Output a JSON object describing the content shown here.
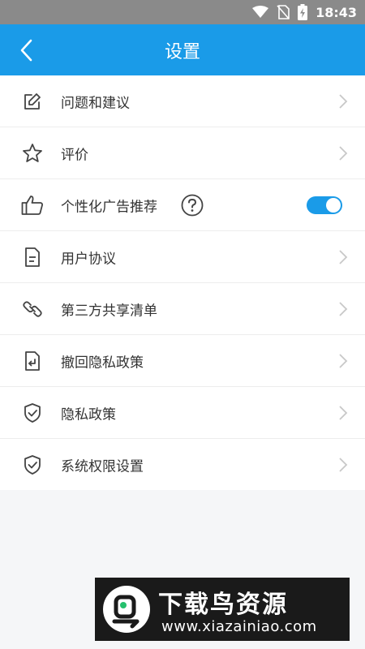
{
  "status_bar": {
    "time": "18:43"
  },
  "header": {
    "title": "设置"
  },
  "settings": {
    "items": [
      {
        "label": "问题和建议",
        "icon": "edit-icon"
      },
      {
        "label": "评价",
        "icon": "star-icon"
      },
      {
        "label": "个性化广告推荐",
        "icon": "thumbs-up-icon",
        "toggle_on": true
      },
      {
        "label": "用户协议",
        "icon": "document-icon"
      },
      {
        "label": "第三方共享清单",
        "icon": "link-icon"
      },
      {
        "label": "撤回隐私政策",
        "icon": "revoke-icon"
      },
      {
        "label": "隐私政策",
        "icon": "shield-check-icon"
      },
      {
        "label": "系统权限设置",
        "icon": "shield-check-icon"
      }
    ]
  },
  "watermark": {
    "title": "下载鸟资源",
    "url": "www.xiazainiao.com"
  },
  "colors": {
    "accent": "#1a9be8",
    "status_bar": "#8a8a8a",
    "background": "#f5f6f8"
  }
}
